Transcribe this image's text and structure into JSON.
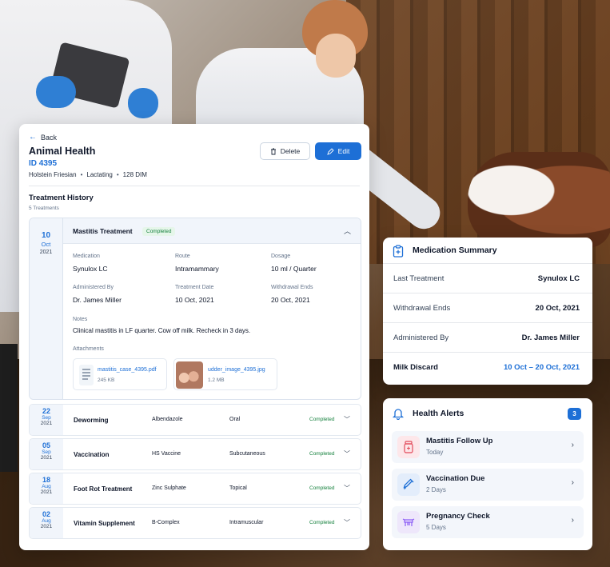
{
  "header": {
    "back_label": "Back",
    "title": "Animal Health",
    "animal_id": "ID 4395",
    "breed": "Holstein Friesian",
    "status": "Lactating",
    "dim": "128 DIM",
    "delete_label": "Delete",
    "edit_label": "Edit"
  },
  "treatment_history": {
    "title": "Treatment History",
    "count": "5 Treatments",
    "expanded": {
      "day": "10",
      "month": "Oct",
      "year": "2021",
      "name": "Mastitis Treatment",
      "status": "Completed",
      "medication_label": "Medication",
      "medication": "Synulox LC",
      "route_label": "Route",
      "route": "Intramammary",
      "dosage_label": "Dosage",
      "dosage": "10 ml / Quarter",
      "administered_label": "Administered By",
      "administered": "Dr. James Miller",
      "date_label": "Treatment Date",
      "date": "10 Oct, 2021",
      "withdrawal_label": "Withdrawal Ends",
      "withdrawal": "20 Oct, 2021",
      "notes_label": "Notes",
      "notes": "Clinical mastitis in LF quarter. Cow off milk. Recheck in 3 days.",
      "attachments_label": "Attachments",
      "attachments": [
        {
          "name": "mastitis_case_4395.pdf",
          "size": "245 KB"
        },
        {
          "name": "udder_image_4395.jpg",
          "size": "1.2 MB"
        }
      ]
    },
    "rows": [
      {
        "day": "22",
        "month": "Sep",
        "year": "2021",
        "name": "Deworming",
        "medication": "Albendazole",
        "route": "Oral",
        "status": "Completed"
      },
      {
        "day": "05",
        "month": "Sep",
        "year": "2021",
        "name": "Vaccination",
        "medication": "HS Vaccine",
        "route": "Subcutaneous",
        "status": "Completed"
      },
      {
        "day": "18",
        "month": "Aug",
        "year": "2021",
        "name": "Foot Rot Treatment",
        "medication": "Zinc Sulphate",
        "route": "Topical",
        "status": "Completed"
      },
      {
        "day": "02",
        "month": "Aug",
        "year": "2021",
        "name": "Vitamin Supplement",
        "medication": "B-Complex",
        "route": "Intramuscular",
        "status": "Completed"
      }
    ]
  },
  "medication_summary": {
    "title": "Medication Summary",
    "rows": [
      {
        "label": "Last Treatment",
        "value": "Synulox LC"
      },
      {
        "label": "Withdrawal Ends",
        "value": "20 Oct, 2021"
      },
      {
        "label": "Administered By",
        "value": "Dr. James Miller"
      },
      {
        "label": "Milk Discard",
        "value": "10 Oct – 20 Oct, 2021"
      }
    ]
  },
  "health_alerts": {
    "title": "Health Alerts",
    "count": "3",
    "items": [
      {
        "title": "Mastitis Follow Up",
        "subtitle": "Today",
        "icon": "medicine-bottle-icon",
        "color": "#e24a5a"
      },
      {
        "title": "Vaccination Due",
        "subtitle": "2 Days",
        "icon": "syringe-icon",
        "color": "#1d6fd6"
      },
      {
        "title": "Pregnancy Check",
        "subtitle": "5 Days",
        "icon": "cow-icon",
        "color": "#8b5cf6"
      }
    ]
  },
  "colors": {
    "accent": "#1d6fd6",
    "success": "#15803d"
  }
}
